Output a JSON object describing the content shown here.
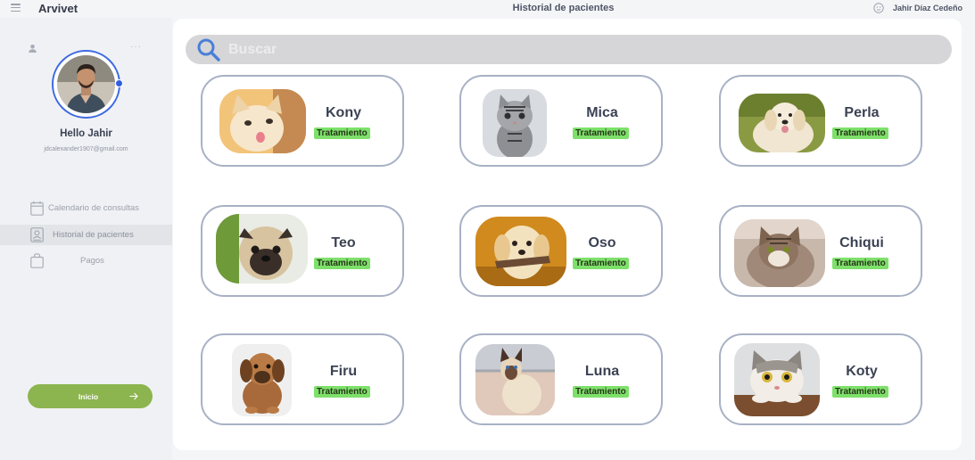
{
  "app": {
    "name": "Arvivet"
  },
  "header": {
    "title": "Historial de pacientes",
    "user_name": "Jahir Díaz Cedeño"
  },
  "sidebar": {
    "greeting": "Hello Jahir",
    "email": "jdcalexander1907@gmail.com",
    "nav": [
      {
        "label": "Calendario de consultas",
        "icon": "calendar-icon",
        "active": false
      },
      {
        "label": "Historial de pacientes",
        "icon": "patient-record-icon",
        "active": true
      },
      {
        "label": "Pagos",
        "icon": "bag-icon",
        "active": false
      }
    ],
    "home_button": "Inicio"
  },
  "search": {
    "placeholder": "Buscar"
  },
  "colors": {
    "accent": "#3d6ae3",
    "home_button": "#8cb44f",
    "tag": "#7ee06b",
    "card_border": "#a8b1c5"
  },
  "patients": [
    {
      "name": "Kony",
      "status": "Tratamiento",
      "photo": "kitten-licking"
    },
    {
      "name": "Mica",
      "status": "Tratamiento",
      "photo": "tabby-kitten"
    },
    {
      "name": "Perla",
      "status": "Tratamiento",
      "photo": "golden-retriever"
    },
    {
      "name": "Teo",
      "status": "Tratamiento",
      "photo": "pug"
    },
    {
      "name": "Oso",
      "status": "Tratamiento",
      "photo": "golden-puppy"
    },
    {
      "name": "Chiqui",
      "status": "Tratamiento",
      "photo": "tabby-cat"
    },
    {
      "name": "Firu",
      "status": "Tratamiento",
      "photo": "brown-puppy"
    },
    {
      "name": "Luna",
      "status": "Tratamiento",
      "photo": "siamese-cat"
    },
    {
      "name": "Koty",
      "status": "Tratamiento",
      "photo": "surprised-cat"
    }
  ]
}
